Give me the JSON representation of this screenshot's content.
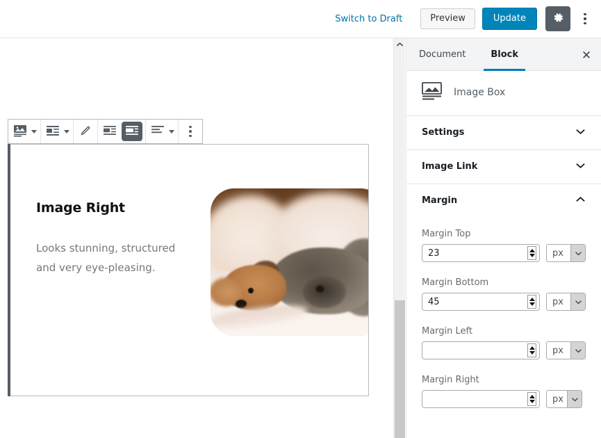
{
  "header": {
    "switch_to_draft": "Switch to Draft",
    "preview": "Preview",
    "update": "Update",
    "settings_icon": "gear-icon",
    "more_icon": "kebab-menu-icon",
    "accent_blue": "#0085ba",
    "link_blue": "#0073aa",
    "gear_bg": "#555d66"
  },
  "toolbar": {
    "items": [
      {
        "icon": "image-block-icon",
        "has_caret": true,
        "active": false
      },
      {
        "icon": "media-layout-icon",
        "has_caret": true,
        "active": false
      },
      {
        "icon": "pencil-edit-icon",
        "has_caret": false,
        "active": false
      },
      {
        "icon": "image-left-layout-icon",
        "has_caret": false,
        "active": false
      },
      {
        "icon": "image-right-layout-icon",
        "has_caret": false,
        "active": true
      },
      {
        "icon": "align-text-icon",
        "has_caret": true,
        "active": false
      },
      {
        "icon": "kebab-menu-icon",
        "has_caret": false,
        "active": false
      }
    ]
  },
  "block": {
    "title": "Image Right",
    "description": " Looks stunning, structured and very eye-pleasing.",
    "image_alt": "two-dogs-sleeping-on-bed-photo",
    "selected": true
  },
  "sidebar": {
    "tabs": [
      {
        "label": "Document",
        "active": false
      },
      {
        "label": "Block",
        "active": true
      }
    ],
    "close_icon": "close-icon",
    "block_card": {
      "icon": "image-box-icon",
      "label": "Image Box"
    },
    "panels": [
      {
        "title": "Settings",
        "expanded": false,
        "chevron": "chevron-down-icon"
      },
      {
        "title": "Image Link",
        "expanded": false,
        "chevron": "chevron-down-icon"
      },
      {
        "title": "Margin",
        "expanded": true,
        "chevron": "chevron-up-icon"
      }
    ],
    "margin_fields": [
      {
        "label": "Margin Top",
        "value": "23",
        "placeholder": "",
        "unit": "px"
      },
      {
        "label": "Margin Bottom",
        "value": "45",
        "placeholder": "",
        "unit": "px"
      },
      {
        "label": "Margin Left",
        "value": "",
        "placeholder": "",
        "unit": "px"
      },
      {
        "label": "Margin Right",
        "value": "",
        "placeholder": "",
        "unit": "px"
      }
    ],
    "tab_underline_color": "#007cba"
  },
  "scrollbar": {
    "up_arrow_icon": "chevron-up-icon",
    "thumb_color": "#c8c8c8"
  }
}
